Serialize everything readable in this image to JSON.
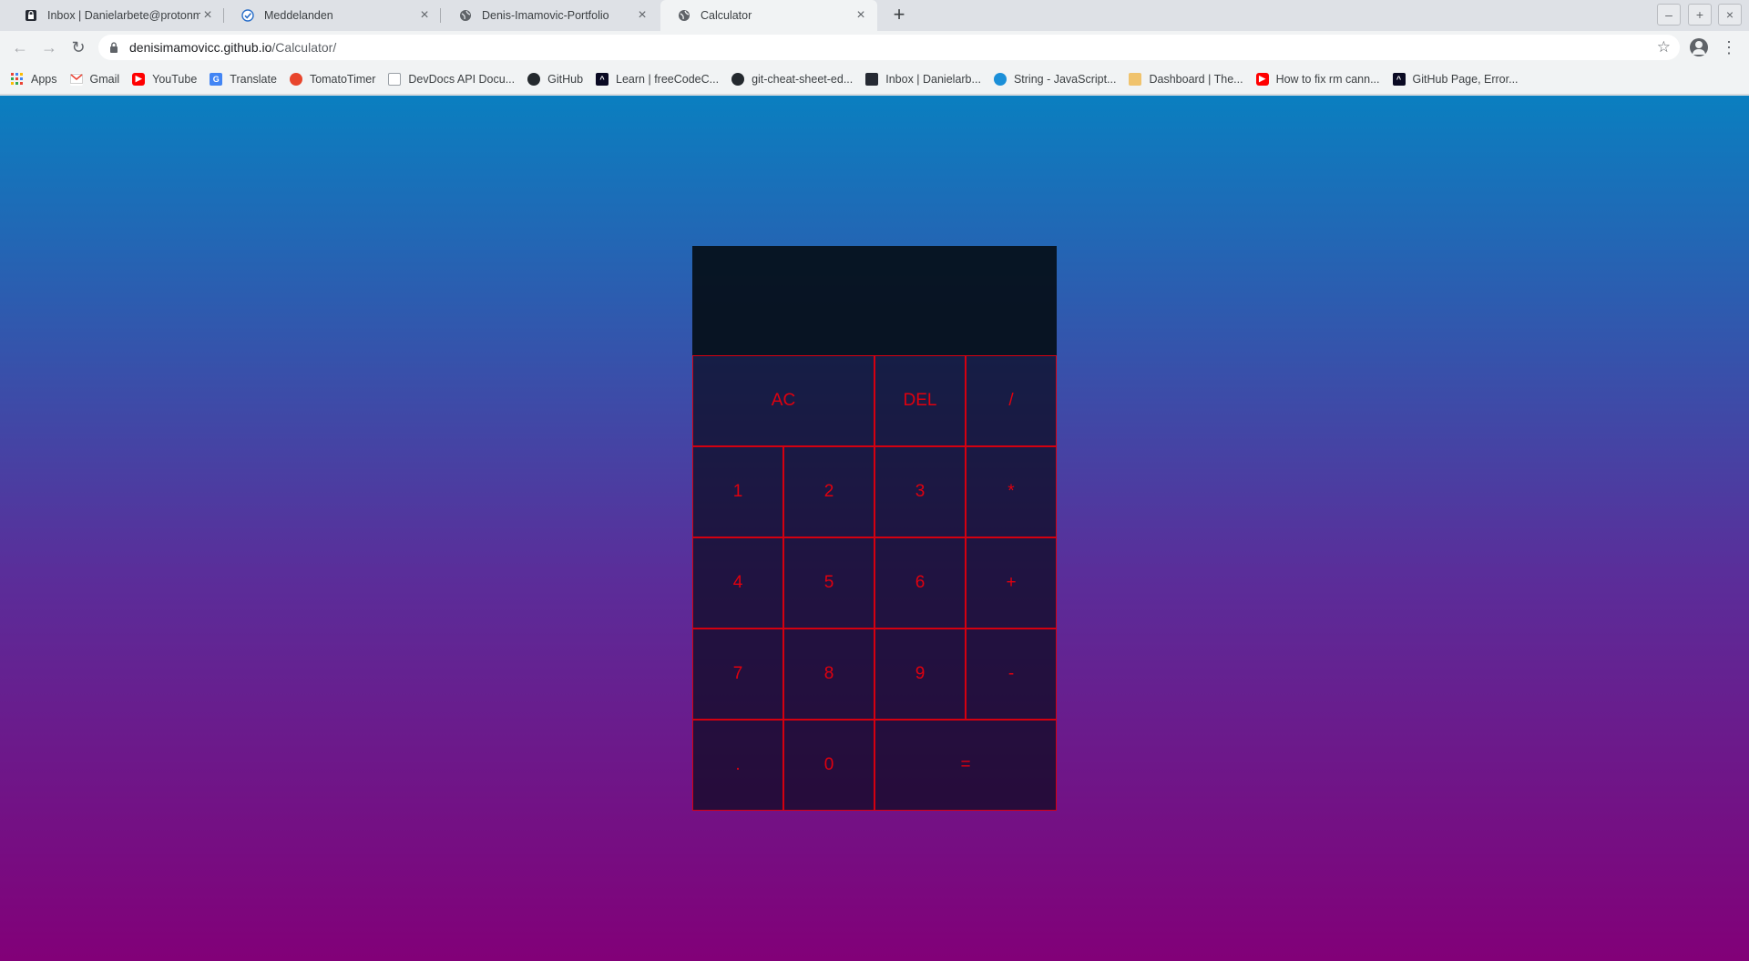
{
  "browser": {
    "tabs": [
      {
        "title": "Inbox | Danielarbete@protonm",
        "icon": "protonmail-icon",
        "active": false
      },
      {
        "title": "Meddelanden",
        "icon": "check-badge-icon",
        "active": false
      },
      {
        "title": "Denis-Imamovic-Portfolio",
        "icon": "globe-icon",
        "active": false
      },
      {
        "title": "Calculator",
        "icon": "globe-icon",
        "active": true
      }
    ],
    "new_tab_label": "+",
    "window_controls": {
      "minimize": "–",
      "maximize": "+",
      "close": "×"
    },
    "url_host": "denisimamovicc.github.io",
    "url_path": "/Calculator/",
    "bookmarks": [
      {
        "label": "Apps",
        "icon": "apps-grid-icon"
      },
      {
        "label": "Gmail",
        "icon": "gmail-icon"
      },
      {
        "label": "YouTube",
        "icon": "youtube-icon"
      },
      {
        "label": "Translate",
        "icon": "translate-icon"
      },
      {
        "label": "TomatoTimer",
        "icon": "tomato-icon"
      },
      {
        "label": "DevDocs API Docu...",
        "icon": "devdocs-icon"
      },
      {
        "label": "GitHub",
        "icon": "github-icon"
      },
      {
        "label": "Learn | freeCodeC...",
        "icon": "freecodecamp-icon"
      },
      {
        "label": "git-cheat-sheet-ed...",
        "icon": "github-icon"
      },
      {
        "label": "Inbox | Danielarb...",
        "icon": "protonmail-icon"
      },
      {
        "label": "String - JavaScript...",
        "icon": "mdn-icon"
      },
      {
        "label": "Dashboard | The...",
        "icon": "theodinproject-icon"
      },
      {
        "label": "How to fix rm cann...",
        "icon": "youtube-icon"
      },
      {
        "label": "GitHub Page, Error...",
        "icon": "freecodecamp-icon"
      }
    ],
    "colors": {
      "tab_strip": "#dee1e6",
      "toolbar": "#f1f3f4"
    }
  },
  "calculator": {
    "previous_operand": "",
    "current_operand": "",
    "keys": {
      "ac": "AC",
      "del": "DEL",
      "divide": "/",
      "one": "1",
      "two": "2",
      "three": "3",
      "multiply": "*",
      "four": "4",
      "five": "5",
      "six": "6",
      "add": "+",
      "seven": "7",
      "eight": "8",
      "nine": "9",
      "subtract": "-",
      "decimal": ".",
      "zero": "0",
      "equals": "="
    },
    "colors": {
      "key_text": "#e0000e",
      "key_border": "#d40010",
      "gradient_top": "#0a7fc0",
      "gradient_bottom": "#820078",
      "display_bg": "#050f19"
    }
  }
}
